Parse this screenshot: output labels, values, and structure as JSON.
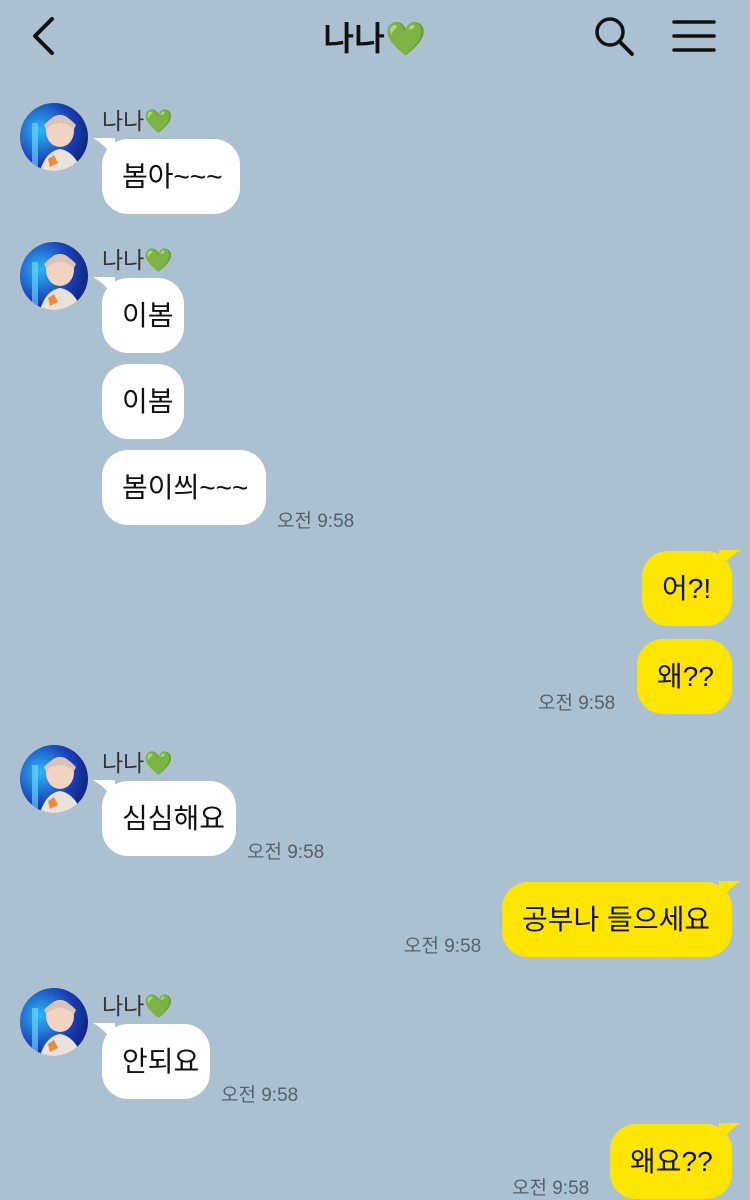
{
  "header": {
    "title": "나나💚"
  },
  "contact_name": "나나💚",
  "messages": [
    {
      "from": "them",
      "text": "봄아~~~"
    },
    {
      "from": "them",
      "text": "이봄"
    },
    {
      "from": "them",
      "text": "이봄"
    },
    {
      "from": "them",
      "text": "봄이씌~~~",
      "time": "오전 9:58"
    },
    {
      "from": "me",
      "text": "어?!"
    },
    {
      "from": "me",
      "text": "왜??",
      "time": "오전 9:58"
    },
    {
      "from": "them",
      "text": "심심해요",
      "time": "오전 9:58"
    },
    {
      "from": "me",
      "text": "공부나 들으세요",
      "time": "오전 9:58"
    },
    {
      "from": "them",
      "text": "안되요",
      "time": "오전 9:58"
    },
    {
      "from": "me",
      "text": "왜요??",
      "time": "오전 9:58"
    }
  ],
  "colors": {
    "background": "#abc1d1",
    "incoming_bubble": "#ffffff",
    "outgoing_bubble": "#fee500"
  }
}
